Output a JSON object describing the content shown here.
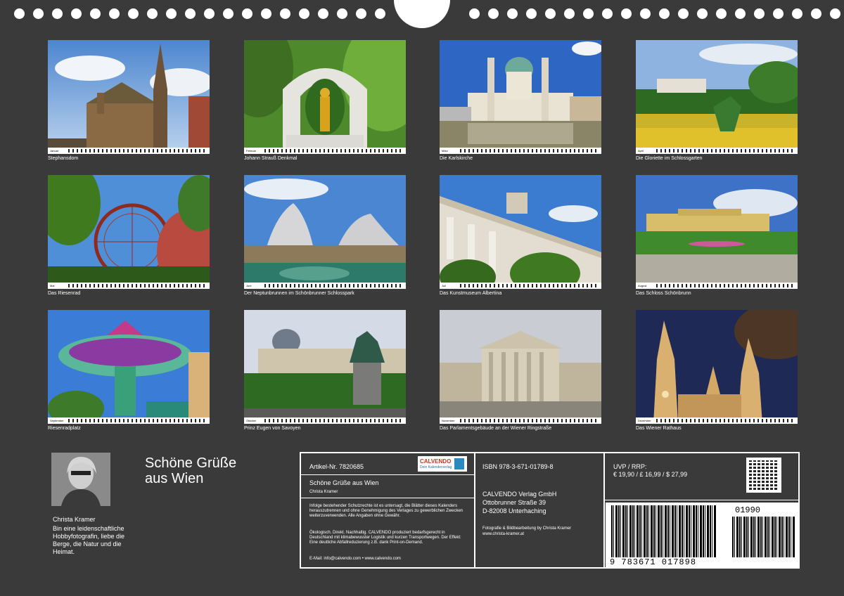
{
  "months": [
    {
      "month": "Januar",
      "caption": "Stephansdom"
    },
    {
      "month": "Februar",
      "caption": "Johann Strauß Denkmal"
    },
    {
      "month": "März",
      "caption": "Die Karlskirche"
    },
    {
      "month": "April",
      "caption": "Die Gloriette im Schlossgarten"
    },
    {
      "month": "Mai",
      "caption": "Das Riesenrad"
    },
    {
      "month": "Juni",
      "caption": "Der Neptunbrunnen im Schönbrunner Schlosspark"
    },
    {
      "month": "Juli",
      "caption": "Das Kunstmuseum Albertina"
    },
    {
      "month": "August",
      "caption": "Das Schloss Schönbrunn"
    },
    {
      "month": "September",
      "caption": "Riesenradplatz"
    },
    {
      "month": "Oktober",
      "caption": "Prinz Eugen von Savoyen"
    },
    {
      "month": "November",
      "caption": "Das Parlamentsgebäude an der Wiener Ringstraße"
    },
    {
      "month": "Dezember",
      "caption": "Das Wiener Rathaus"
    }
  ],
  "author": {
    "name": "Christa Kramer",
    "bio": "Bin eine leidenschaftliche Hobbyfotografin, liebe die Berge, die Natur und die Heimat."
  },
  "title_line1": "Schöne Grüße",
  "title_line2": "aus Wien",
  "info": {
    "article": "Artikel-Nr. 7820685",
    "logo_text": "CALVENDO",
    "logo_sub": "Dein Kalenderverlag",
    "book_title": "Schöne Grüße aus Wien",
    "book_author": "Christa Kramer",
    "legal": "Infolge bestehender Schutzrechte ist es untersagt, die Blätter dieses Kalenders herauszutrennen und ohne Genehmigung des Verlages zu gewerblichen Zwecken weiterzuverwenden. Alle Angaben ohne Gewähr.",
    "eco": "Ökologisch. Direkt. Nachhaltig. CALVENDO produziert bedarfsgerecht in Deutschland mit klimabewusster Logistik und kurzen Transportwegen. Der Effekt: Eine deutliche Abfallreduzierung z.B. dank Print-on-Demand.",
    "email": "E-Mail: info@calvendo.com • www.calvendo.com",
    "isbn": "ISBN 978-3-671-01789-8",
    "publisher1": "CALVENDO Verlag GmbH",
    "publisher2": "Ottobrunner Straße 39",
    "publisher3": "D-82008 Unterhaching",
    "credit1": "Fotografie & Bildbearbeitung by Christa Kramer",
    "credit2": "www.christa-kramer.at",
    "price_label": "UVP / RRP:",
    "prices": "€ 19,90 / £ 16,99 / $ 27,99",
    "barcode_digits": "9 783671 017898",
    "addon_digits": "01990"
  }
}
